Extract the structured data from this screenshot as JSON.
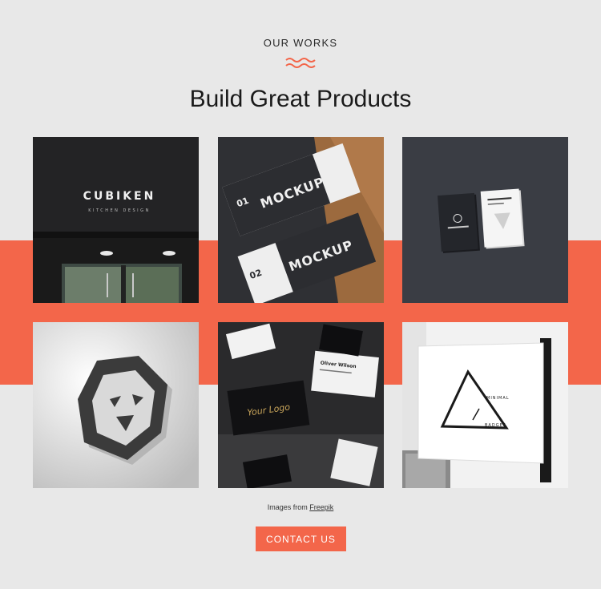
{
  "header": {
    "eyebrow": "OUR WORKS",
    "title": "Build Great Products"
  },
  "accent_color": "#f3664a",
  "gallery": [
    {
      "name": "storefront",
      "sign_line1": "CUBIKEN",
      "sign_line2": "KITCHEN DESIGN"
    },
    {
      "name": "mockup-cards",
      "card1_num": "01",
      "card1_word": "MOCKUP",
      "card2_num": "02",
      "card2_word": "MOCKUP"
    },
    {
      "name": "business-cards-dark"
    },
    {
      "name": "lion-logo"
    },
    {
      "name": "gold-logo-cards",
      "logo_text": "Your Logo",
      "card_name": "Oliver Wilson"
    },
    {
      "name": "hanging-sign",
      "line1": "MINIMAL",
      "line2": "BADGES"
    }
  ],
  "credit": {
    "prefix": "Images from",
    "link": "Freepik"
  },
  "cta": {
    "label": "CONTACT US"
  }
}
